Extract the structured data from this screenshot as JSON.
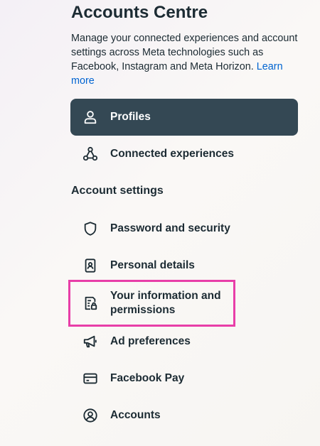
{
  "header": {
    "title": "Accounts Centre",
    "description": "Manage your connected experiences and account settings across Meta technologies such as Facebook, Instagram and Meta Horizon.",
    "learn_more": "Learn more"
  },
  "nav": {
    "profiles": "Profiles",
    "connected_experiences": "Connected experiences"
  },
  "account_settings": {
    "title": "Account settings",
    "items": [
      {
        "label": "Password and security",
        "icon": "shield-icon"
      },
      {
        "label": "Personal details",
        "icon": "id-card-icon"
      },
      {
        "label": "Your information and permissions",
        "icon": "document-lock-icon"
      },
      {
        "label": "Ad preferences",
        "icon": "megaphone-icon"
      },
      {
        "label": "Facebook Pay",
        "icon": "credit-card-icon"
      },
      {
        "label": "Accounts",
        "icon": "user-circle-icon"
      }
    ]
  },
  "colors": {
    "active_bg": "#344854",
    "link": "#0064d1",
    "highlight_border": "#e83ea8"
  }
}
